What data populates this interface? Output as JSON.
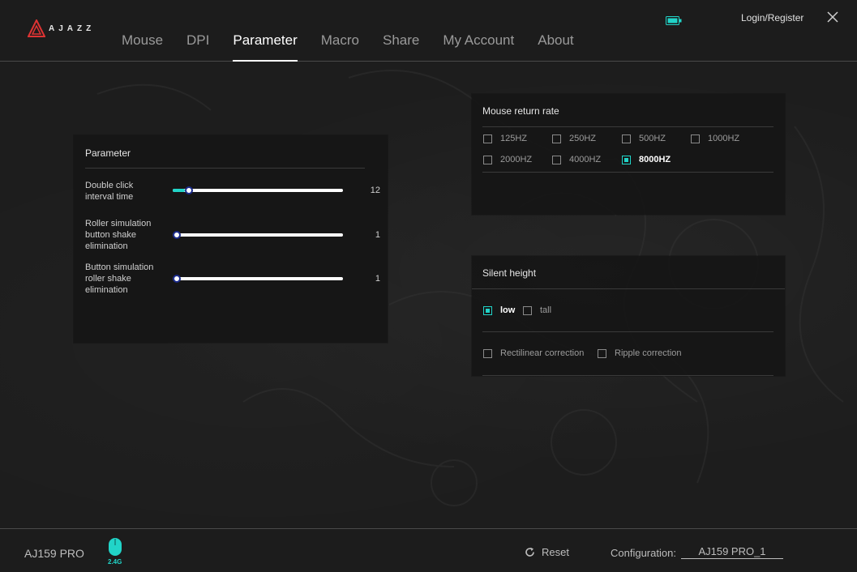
{
  "header": {
    "logo_text": "AJAZZ",
    "nav": [
      {
        "label": "Mouse",
        "active": false
      },
      {
        "label": "DPI",
        "active": false
      },
      {
        "label": "Parameter",
        "active": true
      },
      {
        "label": "Macro",
        "active": false
      },
      {
        "label": "Share",
        "active": false
      },
      {
        "label": "My Account",
        "active": false
      },
      {
        "label": "About",
        "active": false
      }
    ],
    "login_label": "Login/Register"
  },
  "parameter_panel": {
    "title": "Parameter",
    "rows": [
      {
        "label_lines": [
          "Double click",
          "interval time"
        ],
        "value": "12",
        "fill_fraction": 0.07
      },
      {
        "label_lines": [
          "Roller simulation",
          "button shake",
          "elimination"
        ],
        "value": "1",
        "fill_fraction": 0.0
      },
      {
        "label_lines": [
          "Button simulation",
          "roller shake",
          "elimination"
        ],
        "value": "1",
        "fill_fraction": 0.0
      }
    ]
  },
  "return_rate_panel": {
    "title": "Mouse return rate",
    "options": [
      {
        "label": "125HZ",
        "checked": false
      },
      {
        "label": "250HZ",
        "checked": false
      },
      {
        "label": "500HZ",
        "checked": false
      },
      {
        "label": "1000HZ",
        "checked": false
      },
      {
        "label": "2000HZ",
        "checked": false
      },
      {
        "label": "4000HZ",
        "checked": false
      },
      {
        "label": "8000HZ",
        "checked": true
      }
    ]
  },
  "silent_panel": {
    "title": "Silent height",
    "height_options": [
      {
        "label": "low",
        "checked": true
      },
      {
        "label": "tall",
        "checked": false
      }
    ],
    "correction_options": [
      {
        "label": "Rectilinear correction",
        "checked": false
      },
      {
        "label": "Ripple correction",
        "checked": false
      }
    ]
  },
  "footer": {
    "device_name": "AJ159 PRO",
    "connection": "2.4G",
    "reset_label": "Reset",
    "config_label": "Configuration:",
    "config_value": "AJ159 PRO_1"
  },
  "colors": {
    "accent": "#21d4c8",
    "background": "#1c1c1c",
    "panel": "#161616"
  }
}
